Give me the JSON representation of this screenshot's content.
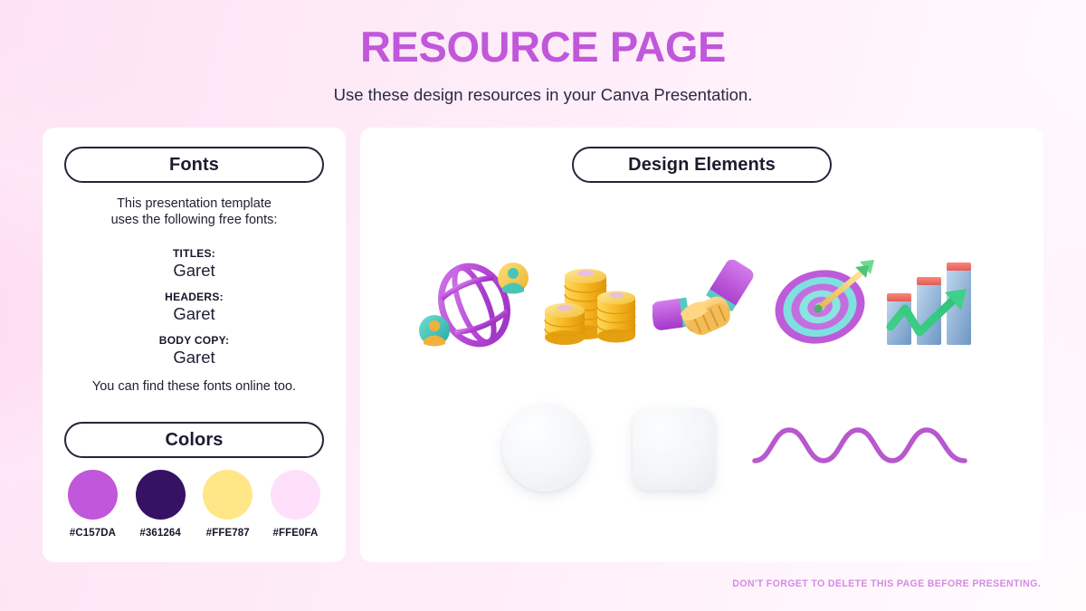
{
  "header": {
    "title": "RESOURCE PAGE",
    "subtitle": "Use these design resources in your Canva Presentation."
  },
  "fonts_panel": {
    "heading": "Fonts",
    "intro_line1": "This presentation template",
    "intro_line2": "uses the following free fonts:",
    "groups": [
      {
        "label": "TITLES:",
        "value": "Garet"
      },
      {
        "label": "HEADERS:",
        "value": "Garet"
      },
      {
        "label": "BODY COPY:",
        "value": "Garet"
      }
    ],
    "outro": "You can find these fonts online too."
  },
  "colors_panel": {
    "heading": "Colors",
    "swatches": [
      {
        "hex": "#C157DA"
      },
      {
        "hex": "#361264"
      },
      {
        "hex": "#FFE787"
      },
      {
        "hex": "#FFE0FA"
      }
    ]
  },
  "design_panel": {
    "heading": "Design Elements",
    "icons": [
      {
        "name": "globe-network-icon",
        "label": "globe"
      },
      {
        "name": "coin-stacks-icon",
        "label": "coins"
      },
      {
        "name": "handshake-icon",
        "label": "handshake"
      },
      {
        "name": "target-arrow-icon",
        "label": "target"
      },
      {
        "name": "growth-bar-chart-icon",
        "label": "growth chart"
      }
    ],
    "shapes": [
      {
        "name": "circle-shape",
        "label": "circle"
      },
      {
        "name": "rounded-square-shape",
        "label": "rounded square"
      },
      {
        "name": "wavy-line-shape",
        "label": "wave"
      }
    ]
  },
  "footer": {
    "note": "DON'T FORGET TO DELETE THIS PAGE BEFORE PRESENTING."
  },
  "theme": {
    "accent": "#C157DA",
    "dark": "#361264",
    "yellow": "#FFE787",
    "pale_pink": "#FFE0FA",
    "text": "#1F1E33",
    "wave_color": "#B858CE"
  }
}
